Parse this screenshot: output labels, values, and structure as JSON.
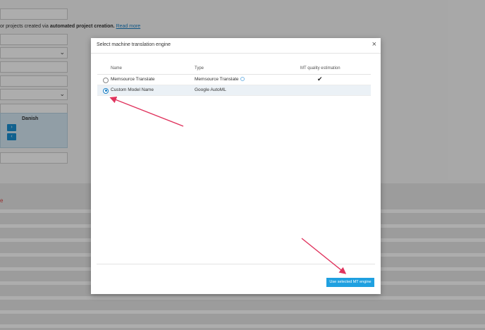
{
  "background": {
    "note_prefix": "or projects created via ",
    "note_bold": "automated project creation.",
    "note_link": "Read more",
    "panel_label": "Danish",
    "arrow_right": "›",
    "arrow_left": "‹",
    "select_chevron": "⌄",
    "red_text": "e"
  },
  "modal": {
    "title": "Select machine translation engine",
    "close_label": "×",
    "columns": {
      "name": "Name",
      "type": "Type",
      "quality": "MT quality estimation"
    },
    "engines": [
      {
        "name": "Memsource Translate",
        "type": "Memsource Translate",
        "quality_supported": true,
        "selected": false
      },
      {
        "name": "Custom Model Name",
        "type": "Google AutoML",
        "quality_supported": false,
        "selected": true
      }
    ],
    "confirm_button": "Use selected MT engine"
  },
  "colors": {
    "primary": "#1fa0e0",
    "arrow": "#e0345e",
    "selected_row": "#ebf1f6"
  }
}
